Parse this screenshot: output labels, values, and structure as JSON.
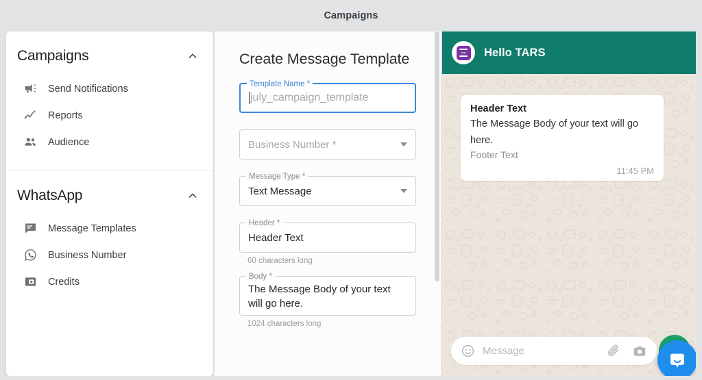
{
  "topbar": {
    "title": "Campaigns"
  },
  "sidebar": {
    "sections": [
      {
        "title": "Campaigns",
        "collapse_icon": "chevron-up-icon",
        "items": [
          {
            "label": "Send Notifications",
            "icon": "megaphone-icon"
          },
          {
            "label": "Reports",
            "icon": "insights-chart-icon"
          },
          {
            "label": "Audience",
            "icon": "people-icon"
          }
        ]
      },
      {
        "title": "WhatsApp",
        "collapse_icon": "chevron-up-icon",
        "items": [
          {
            "label": "Message Templates",
            "icon": "chat-bubble-icon"
          },
          {
            "label": "Business Number",
            "icon": "whatsapp-icon"
          },
          {
            "label": "Credits",
            "icon": "wallet-icon"
          }
        ]
      }
    ]
  },
  "form": {
    "title": "Create Message Template",
    "template_name": {
      "label": "Template Name *",
      "placeholder": "july_campaign_template",
      "value": "",
      "focused": true,
      "accent_color": "#3a86d6"
    },
    "business_number": {
      "placeholder": "Business Number *",
      "value": "",
      "dropdown_icon": "chevron-down-icon"
    },
    "message_type": {
      "label": "Message Type *",
      "value": "Text Message",
      "dropdown_icon": "chevron-down-icon"
    },
    "header": {
      "label": "Header *",
      "value": "Header Text",
      "helper": "60 characters long"
    },
    "body": {
      "label": "Body *",
      "value": "The Message Body of your text will go here.",
      "helper": "1024 characters long"
    }
  },
  "preview": {
    "header": {
      "contact_name": "Hello TARS",
      "avatar_icon": "tars-logo-icon",
      "bar_color": "#0f7c6c"
    },
    "message": {
      "header_text": "Header Text",
      "body_text": "The Message Body of your text will go here.",
      "footer_text": "Footer Text",
      "time": "11:45 PM"
    },
    "composer": {
      "placeholder": "Message",
      "emoji_icon": "emoji-smile-icon",
      "attach_icon": "paperclip-icon",
      "camera_icon": "camera-icon",
      "send_icon": "send-button",
      "send_color": "#1aa06a"
    },
    "launcher": {
      "icon": "intercom-chat-icon",
      "color": "#1f8ded"
    }
  }
}
